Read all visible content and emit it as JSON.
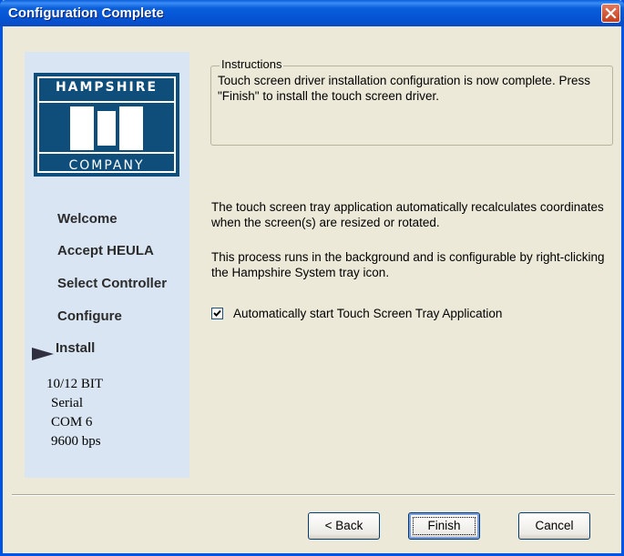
{
  "window": {
    "title": "Configuration Complete"
  },
  "logo": {
    "top_text": "HAMPSHIRE",
    "bottom_text": "COMPANY"
  },
  "steps": [
    {
      "label": "Welcome"
    },
    {
      "label": "Accept HEULA"
    },
    {
      "label": "Select Controller"
    },
    {
      "label": "Configure"
    },
    {
      "label": "Install",
      "current": true
    }
  ],
  "device_info": [
    "10/12 BIT",
    "Serial",
    "COM 6",
    "9600 bps"
  ],
  "instructions": {
    "legend": "Instructions",
    "text": "Touch screen driver installation configuration is now complete.  Press \"Finish\" to install the touch screen driver."
  },
  "paragraphs": [
    "The touch screen tray application automatically recalculates coordinates when the screen(s) are resized or rotated.",
    "This process runs in the background and is configurable by right-clicking the Hampshire System tray icon."
  ],
  "autostart": {
    "label": "Automatically start Touch Screen Tray Application",
    "checked": true
  },
  "buttons": {
    "back": "< Back",
    "finish": "Finish",
    "cancel": "Cancel"
  },
  "colors": {
    "title_bar": "#0A5FDB",
    "sidebar": "#D9E5F2",
    "logo_bg": "#0F4E7B",
    "dialog_bg": "#ECE9D8",
    "close": "#C33F1E"
  },
  "icons": {
    "close": "close-icon",
    "current_step": "arrow-right-icon",
    "check": "checkmark-icon"
  }
}
